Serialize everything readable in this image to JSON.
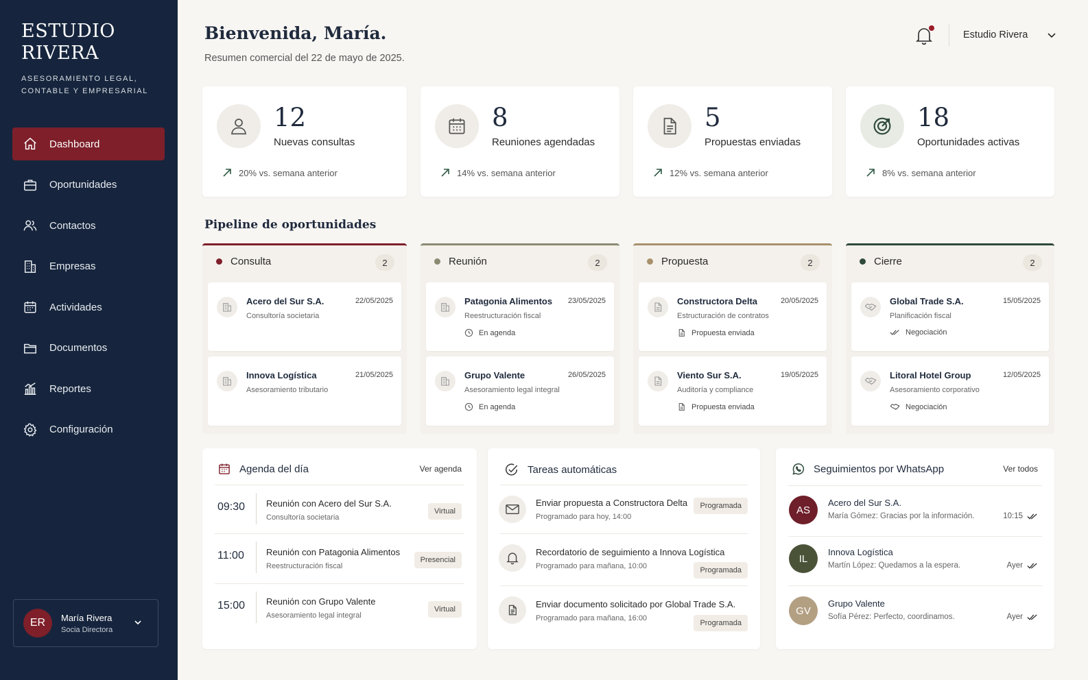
{
  "brand": {
    "name": "ESTUDIO\nRIVERA",
    "tagline": "ASESORAMIENTO LEGAL,\nCONTABLE Y EMPRESARIAL"
  },
  "nav": [
    {
      "label": "Dashboard",
      "icon": "home-icon",
      "active": true
    },
    {
      "label": "Oportunidades",
      "icon": "briefcase-icon"
    },
    {
      "label": "Contactos",
      "icon": "users-icon"
    },
    {
      "label": "Empresas",
      "icon": "building-icon"
    },
    {
      "label": "Actividades",
      "icon": "calendar-icon"
    },
    {
      "label": "Documentos",
      "icon": "folder-icon"
    },
    {
      "label": "Reportes",
      "icon": "chart-icon"
    },
    {
      "label": "Configuración",
      "icon": "gear-icon"
    }
  ],
  "user": {
    "initials": "ER",
    "name": "María Rivera",
    "role": "Socia Directora"
  },
  "header": {
    "greeting": "Bienvenida, María.",
    "subtitle": "Resumen comercial del 22 de mayo de 2025.",
    "studio": "Estudio Rivera"
  },
  "stats": [
    {
      "value": "12",
      "label": "Nuevas consultas",
      "trend": "20% vs. semana anterior",
      "icon": "user-icon"
    },
    {
      "value": "8",
      "label": "Reuniones agendadas",
      "trend": "14% vs. semana anterior",
      "icon": "calendar-icon"
    },
    {
      "value": "5",
      "label": "Propuestas enviadas",
      "trend": "12% vs. semana anterior",
      "icon": "document-icon"
    },
    {
      "value": "18",
      "label": "Oportunidades activas",
      "trend": "8% vs. semana anterior",
      "icon": "target-icon"
    }
  ],
  "pipeline": {
    "title": "Pipeline de oportunidades",
    "columns": [
      {
        "name": "Consulta",
        "count": "2",
        "color": "#7e1f2a",
        "cards": [
          {
            "company": "Acero del Sur S.A.",
            "date": "22/05/2025",
            "service": "Consultoría societaria",
            "status": ""
          },
          {
            "company": "Innova Logística",
            "date": "21/05/2025",
            "service": "Asesoramiento tributario",
            "status": ""
          }
        ]
      },
      {
        "name": "Reunión",
        "count": "2",
        "color": "#8a8a72",
        "cards": [
          {
            "company": "Patagonia Alimentos",
            "date": "23/05/2025",
            "service": "Reestructuración fiscal",
            "status": "En agenda"
          },
          {
            "company": "Grupo Valente",
            "date": "26/05/2025",
            "service": "Asesoramiento legal integral",
            "status": "En agenda"
          }
        ]
      },
      {
        "name": "Propuesta",
        "count": "2",
        "color": "#a8906c",
        "cards": [
          {
            "company": "Constructora Delta",
            "date": "20/05/2025",
            "service": "Estructuración de contratos",
            "status": "Propuesta enviada"
          },
          {
            "company": "Viento Sur S.A.",
            "date": "19/05/2025",
            "service": "Auditoría y compliance",
            "status": "Propuesta enviada"
          }
        ]
      },
      {
        "name": "Cierre",
        "count": "2",
        "color": "#2f4a3a",
        "cards": [
          {
            "company": "Global Trade S.A.",
            "date": "15/05/2025",
            "service": "Planificación fiscal",
            "status": "Negociación"
          },
          {
            "company": "Litoral Hotel Group",
            "date": "12/05/2025",
            "service": "Asesoramiento corporativo",
            "status": "Negociación"
          }
        ]
      }
    ]
  },
  "agenda": {
    "title": "Agenda del día",
    "link": "Ver agenda",
    "items": [
      {
        "time": "09:30",
        "title": "Reunión con Acero del Sur S.A.",
        "sub": "Consultoría societaria",
        "mode": "Virtual"
      },
      {
        "time": "11:00",
        "title": "Reunión con Patagonia Alimentos",
        "sub": "Reestructuración fiscal",
        "mode": "Presencial"
      },
      {
        "time": "15:00",
        "title": "Reunión con Grupo Valente",
        "sub": "Asesoramiento legal integral",
        "mode": "Virtual"
      }
    ]
  },
  "tasks": {
    "title": "Tareas automáticas",
    "items": [
      {
        "title": "Enviar propuesta a Constructora Delta",
        "sub": "Programado para hoy, 14:00",
        "status": "Programada",
        "icon": "mail-icon"
      },
      {
        "title": "Recordatorio de seguimiento a Innova Logística",
        "sub": "Programado para mañana, 10:00",
        "status": "Programada",
        "icon": "bell-icon"
      },
      {
        "title": "Enviar documento solicitado por Global Trade S.A.",
        "sub": "Programado para mañana, 16:00",
        "status": "Programada",
        "icon": "document-icon"
      }
    ]
  },
  "whatsapp": {
    "title": "Seguimientos por WhatsApp",
    "link": "Ver todos",
    "items": [
      {
        "initials": "AS",
        "name": "Acero del Sur S.A.",
        "msg": "María Gómez: Gracias por la información.",
        "time": "10:15",
        "color": "#6e1f2a"
      },
      {
        "initials": "IL",
        "name": "Innova Logística",
        "msg": "Martín López: Quedamos a la espera.",
        "time": "Ayer",
        "color": "#4a5238"
      },
      {
        "initials": "GV",
        "name": "Grupo Valente",
        "msg": "Sofía Pérez: Perfecto, coordinamos.",
        "time": "Ayer",
        "color": "#b39f82"
      }
    ]
  }
}
